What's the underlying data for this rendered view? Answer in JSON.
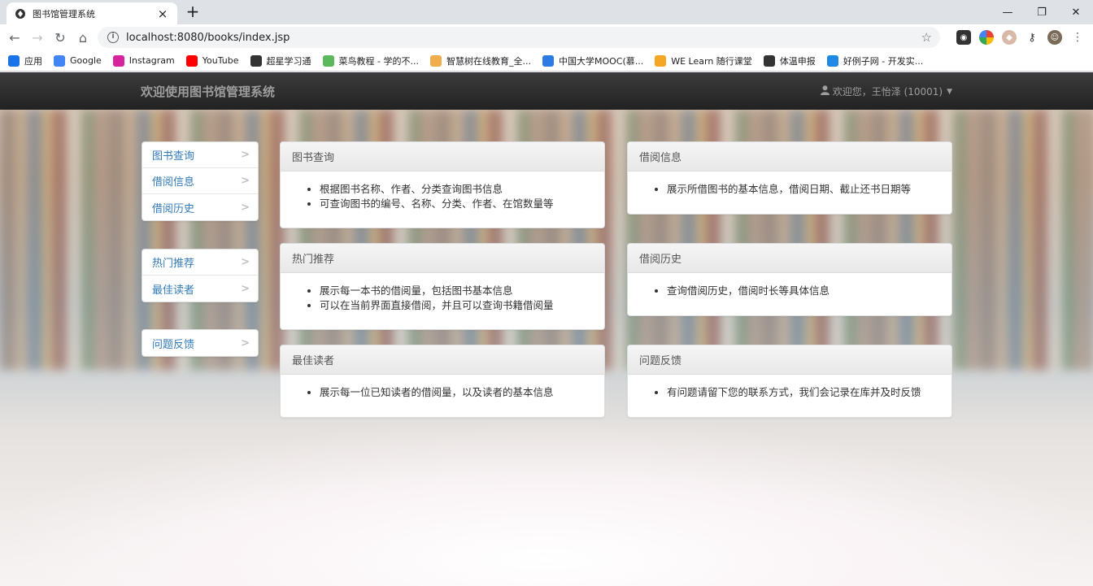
{
  "browser": {
    "tab_title": "图书馆管理系统",
    "url": "localhost:8080/books/index.jsp",
    "bookmarks": [
      {
        "label": "应用",
        "icon": "apps-grid-icon",
        "color": "#1a73e8"
      },
      {
        "label": "Google",
        "icon": "google-icon",
        "color": "#4285f4"
      },
      {
        "label": "Instagram",
        "icon": "instagram-icon",
        "color": "#d6249f"
      },
      {
        "label": "YouTube",
        "icon": "youtube-icon",
        "color": "#ff0000"
      },
      {
        "label": "超星学习通",
        "icon": "globe-icon",
        "color": "#333333"
      },
      {
        "label": "菜鸟教程 - 学的不...",
        "icon": "runoob-icon",
        "color": "#5cb85c"
      },
      {
        "label": "智慧树在线教育_全...",
        "icon": "zhihuishu-icon",
        "color": "#f0ad4e"
      },
      {
        "label": "中国大学MOOC(慕...",
        "icon": "mooc-icon",
        "color": "#2c7be5"
      },
      {
        "label": "WE Learn 随行课堂",
        "icon": "welearn-icon",
        "color": "#f5a623"
      },
      {
        "label": "体温申报",
        "icon": "globe-icon",
        "color": "#333333"
      },
      {
        "label": "好例子网 - 开发实...",
        "icon": "haolizi-icon",
        "color": "#1e88e5"
      }
    ]
  },
  "app": {
    "brand": "欢迎使用图书馆管理系统",
    "user": "欢迎您，王怡泽 (10001)"
  },
  "sidebar": {
    "groups": [
      [
        "图书查询",
        "借阅信息",
        "借阅历史"
      ],
      [
        "热门推荐",
        "最佳读者"
      ],
      [
        "问题反馈"
      ]
    ]
  },
  "panels": [
    {
      "title": "图书查询",
      "items": [
        "根据图书名称、作者、分类查询图书信息",
        "可查询图书的编号、名称、分类、作者、在馆数量等"
      ]
    },
    {
      "title": "借阅信息",
      "items": [
        "展示所借图书的基本信息，借阅日期、截止还书日期等"
      ]
    },
    {
      "title": "热门推荐",
      "items": [
        "展示每一本书的借阅量，包括图书基本信息",
        "可以在当前界面直接借阅，并且可以查询书籍借阅量"
      ]
    },
    {
      "title": "借阅历史",
      "items": [
        "查询借阅历史，借阅时长等具体信息"
      ]
    },
    {
      "title": "最佳读者",
      "items": [
        "展示每一位已知读者的借阅量，以及读者的基本信息"
      ]
    },
    {
      "title": "问题反馈",
      "items": [
        "有问题请留下您的联系方式，我们会记录在库并及时反馈"
      ]
    }
  ]
}
